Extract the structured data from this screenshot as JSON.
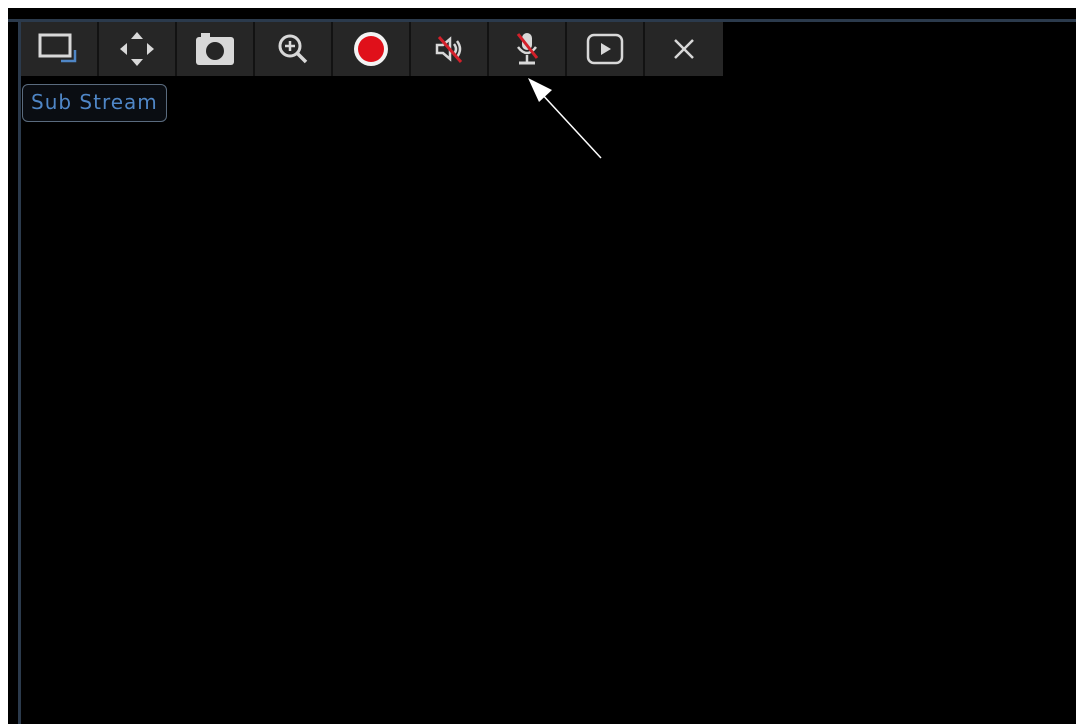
{
  "toolbar": {
    "buttons": [
      {
        "name": "stream-switch-button",
        "icon": "stream-switch-icon"
      },
      {
        "name": "ptz-button",
        "icon": "ptz-arrows-icon"
      },
      {
        "name": "snapshot-button",
        "icon": "camera-icon"
      },
      {
        "name": "zoom-button",
        "icon": "zoom-in-icon"
      },
      {
        "name": "record-button",
        "icon": "record-icon"
      },
      {
        "name": "audio-button",
        "icon": "speaker-muted-icon"
      },
      {
        "name": "talk-button",
        "icon": "microphone-muted-icon"
      },
      {
        "name": "playback-button",
        "icon": "play-icon"
      },
      {
        "name": "close-button",
        "icon": "close-icon"
      }
    ]
  },
  "tooltip": {
    "text": "Sub Stream"
  },
  "colors": {
    "background": "#000000",
    "toolbar": "#262626",
    "icon": "#d8d8d8",
    "record": "#e0101a",
    "mute_slash": "#d3202a",
    "stream_accent": "#4f86c6",
    "tooltip_text": "#4f86c6",
    "frame": "#2b3a4c",
    "annotation_arrow": "#ffffff"
  }
}
